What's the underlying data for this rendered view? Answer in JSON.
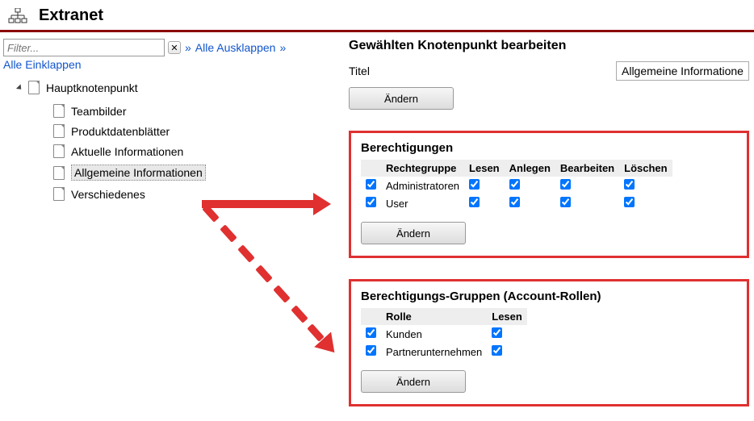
{
  "header": {
    "title": "Extranet"
  },
  "filter": {
    "placeholder": "Filter...",
    "expand_all": "Alle Ausklappen",
    "collapse_all": "Alle Einklappen",
    "sep": "»"
  },
  "tree": {
    "root": "Hauptknotenpunkt",
    "children": [
      "Teambilder",
      "Produktdatenblätter",
      "Aktuelle Informationen",
      "Allgemeine Informationen",
      "Verschiedenes"
    ],
    "selected_index": 3
  },
  "editor": {
    "heading": "Gewählten Knotenpunkt bearbeiten",
    "title_label": "Titel",
    "title_value": "Allgemeine Informationen",
    "change_btn": "Ändern"
  },
  "permissions": {
    "heading": "Berechtigungen",
    "columns": [
      "",
      "Rechtegruppe",
      "Lesen",
      "Anlegen",
      "Bearbeiten",
      "Löschen"
    ],
    "rows": [
      {
        "enabled": true,
        "group": "Administratoren",
        "read": true,
        "create": true,
        "edit": true,
        "delete": true
      },
      {
        "enabled": true,
        "group": "User",
        "read": true,
        "create": true,
        "edit": true,
        "delete": true
      }
    ],
    "change_btn": "Ändern"
  },
  "role_groups": {
    "heading": "Berechtigungs-Gruppen (Account-Rollen)",
    "columns": [
      "",
      "Rolle",
      "Lesen"
    ],
    "rows": [
      {
        "enabled": true,
        "role": "Kunden",
        "read": true
      },
      {
        "enabled": true,
        "role": "Partnerunternehmen",
        "read": true
      }
    ],
    "change_btn": "Ändern"
  }
}
